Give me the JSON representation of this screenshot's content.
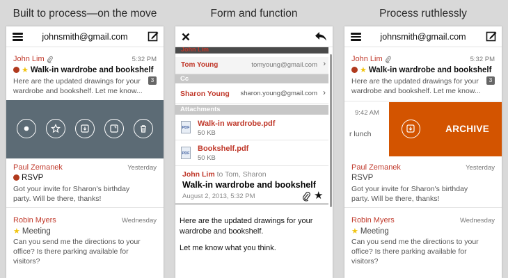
{
  "captions": [
    "Built to process—on the move",
    "Form and function",
    "Process ruthlessly"
  ],
  "account": "johnsmith@gmail.com",
  "panel1": {
    "msg1": {
      "sender": "John Lim",
      "time": "5:32 PM",
      "subject": "Walk-in wardrobe and bookshelf",
      "preview": "Here are the updated drawings for your wardrobe and bookshelf. Let me know...",
      "count": "3"
    },
    "msg2": {
      "sender": "Paul Zemanek",
      "time": "Yesterday",
      "subject": "RSVP",
      "preview": "Got your invite for Sharon's birthday party. Will be there, thanks!"
    },
    "msg3": {
      "sender": "Robin Myers",
      "time": "Wednesday",
      "subject": "Meeting",
      "preview": "Can you send me the directions to your office? Is there parking available for visitors?"
    }
  },
  "panel2": {
    "stack1": "John Lim",
    "stack2": {
      "name": "Tom Young",
      "email": "tomyoung@gmail.com"
    },
    "cc_label": "Cc",
    "cc": {
      "name": "Sharon Young",
      "email": "sharon.young@gmail.com"
    },
    "attachments_label": "Attachments",
    "files": [
      {
        "name": "Walk-in wardrobe.pdf",
        "size": "50 KB",
        "type": "PDF"
      },
      {
        "name": "Bookshelf.pdf",
        "size": "50 KB",
        "type": "PDF"
      }
    ],
    "from": "John Lim",
    "to": "to Tom, Sharon",
    "subject": "Walk-in wardrobe and bookshelf",
    "date": "August 2, 2013, 5:32 PM",
    "body1": "Here are the updated drawings for your wardrobe and bookshelf.",
    "body2": "Let me know what you think."
  },
  "panel3": {
    "msg1": {
      "sender": "John Lim",
      "time": "5:32 PM",
      "subject": "Walk-in wardrobe and bookshelf",
      "preview": "Here are the updated drawings for your wardrobe and bookshelf. Let me know...",
      "count": "3"
    },
    "swiped": {
      "time": "9:42 AM",
      "preview": "r lunch",
      "action": "ARCHIVE"
    },
    "msg2": {
      "sender": "Paul Zemanek",
      "time": "Yesterday",
      "subject": "RSVP",
      "preview": "Got your invite for Sharon's birthday party. Will be there, thanks!"
    },
    "msg3": {
      "sender": "Robin Myers",
      "time": "Wednesday",
      "subject": "Meeting",
      "preview": "Can you send me the directions to your office? Is there parking available for visitors?"
    }
  },
  "colors": {
    "accent": "#c0392b",
    "archive": "#d35400",
    "actionbar": "#5c6b75"
  }
}
